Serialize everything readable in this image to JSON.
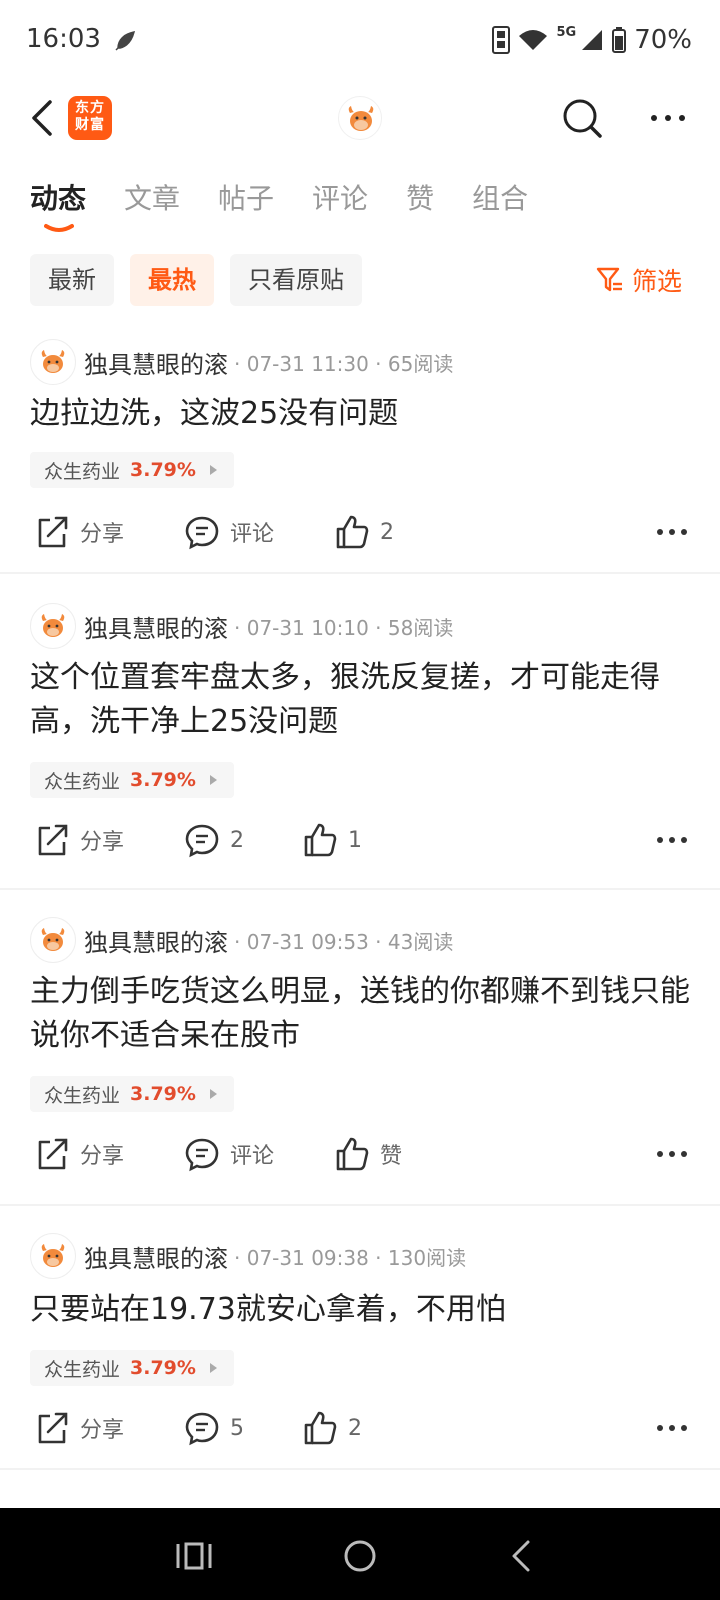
{
  "status_bar": {
    "time": "16:03",
    "network": "5G",
    "battery": "70%",
    "icons": [
      "feather-icon",
      "data-transfer-icon",
      "wifi-icon",
      "signal-icon",
      "battery-icon"
    ]
  },
  "header": {
    "brand_logo_text": "东方财富",
    "icons": [
      "back-arrow-icon",
      "bull-avatar-icon",
      "search-icon",
      "more-icon"
    ]
  },
  "tabs": [
    {
      "label": "动态",
      "active": true
    },
    {
      "label": "文章",
      "active": false
    },
    {
      "label": "帖子",
      "active": false
    },
    {
      "label": "评论",
      "active": false
    },
    {
      "label": "赞",
      "active": false
    },
    {
      "label": "组合",
      "active": false
    }
  ],
  "filters": {
    "chips": [
      {
        "label": "最新",
        "active": false
      },
      {
        "label": "最热",
        "active": true
      },
      {
        "label": "只看原贴",
        "active": false
      }
    ],
    "filter_label": "筛选"
  },
  "posts": [
    {
      "author": "独具慧眼的滚",
      "meta": "· 07-31 11:30 · 65阅读",
      "text": "边拉边洗，这波25没有问题",
      "stock_name": "众生药业",
      "stock_change": "3.79%",
      "share_label": "分享",
      "comment_label": "评论",
      "like_label": "2"
    },
    {
      "author": "独具慧眼的滚",
      "meta": "· 07-31 10:10 · 58阅读",
      "text": "这个位置套牢盘太多，狠洗反复搓，才可能走得高，洗干净上25没问题",
      "stock_name": "众生药业",
      "stock_change": "3.79%",
      "share_label": "分享",
      "comment_label": "2",
      "like_label": "1"
    },
    {
      "author": "独具慧眼的滚",
      "meta": "· 07-31 09:53 · 43阅读",
      "text": "主力倒手吃货这么明显，送钱的你都赚不到钱只能说你不适合呆在股市",
      "stock_name": "众生药业",
      "stock_change": "3.79%",
      "share_label": "分享",
      "comment_label": "评论",
      "like_label": "赞"
    },
    {
      "author": "独具慧眼的滚",
      "meta": "· 07-31 09:38 · 130阅读",
      "text": "只要站在19.73就安心拿着，不用怕",
      "stock_name": "众生药业",
      "stock_change": "3.79%",
      "share_label": "分享",
      "comment_label": "5",
      "like_label": "2"
    }
  ],
  "colors": {
    "accent": "#ff5a14",
    "stock_up": "#e24c2d",
    "text": "#222222",
    "muted": "#999999"
  },
  "nav_bar": {
    "icons": [
      "recent-apps-icon",
      "home-icon",
      "back-icon"
    ]
  }
}
